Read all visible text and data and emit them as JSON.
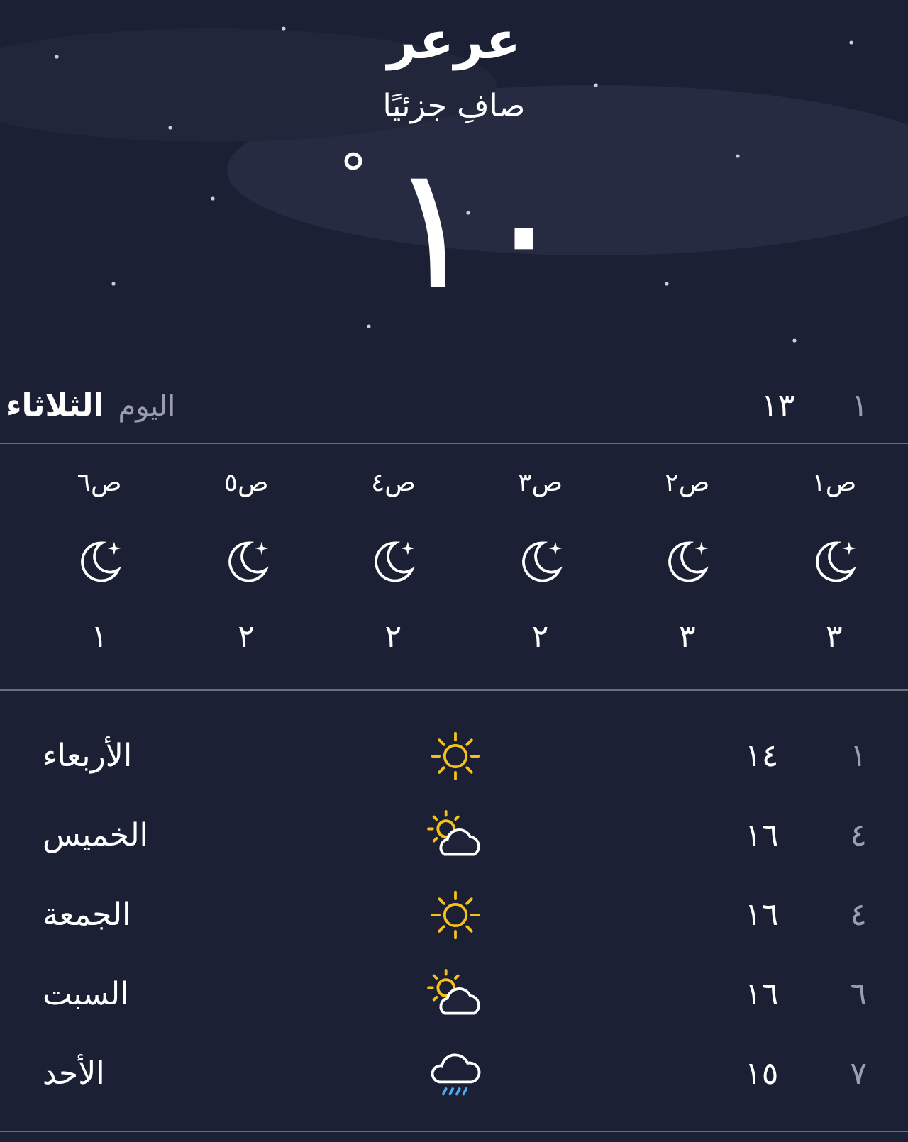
{
  "location": {
    "city": "عرعر",
    "condition": "صافِ جزئيًا",
    "temperature": "١٠",
    "degree": "°"
  },
  "today": {
    "day": "الثلاثاء",
    "label": "اليوم",
    "high": "١٣",
    "low": "١"
  },
  "hourly": [
    {
      "time": "ص١",
      "kind": "night-clear",
      "temp": "٣"
    },
    {
      "time": "ص٢",
      "kind": "night-clear",
      "temp": "٣"
    },
    {
      "time": "ص٣",
      "kind": "night-clear",
      "temp": "٢"
    },
    {
      "time": "ص٤",
      "kind": "night-clear",
      "temp": "٢"
    },
    {
      "time": "ص٥",
      "kind": "night-clear",
      "temp": "٢"
    },
    {
      "time": "ص٦",
      "kind": "night-clear",
      "temp": "١"
    }
  ],
  "daily": [
    {
      "day": "الأربعاء",
      "kind": "sun",
      "high": "١٤",
      "low": "١"
    },
    {
      "day": "الخميس",
      "kind": "partly-cloudy",
      "high": "١٦",
      "low": "٤"
    },
    {
      "day": "الجمعة",
      "kind": "sun",
      "high": "١٦",
      "low": "٤"
    },
    {
      "day": "السبت",
      "kind": "partly-cloudy",
      "high": "١٦",
      "low": "٦"
    },
    {
      "day": "الأحد",
      "kind": "rain",
      "high": "١٥",
      "low": "٧"
    }
  ]
}
